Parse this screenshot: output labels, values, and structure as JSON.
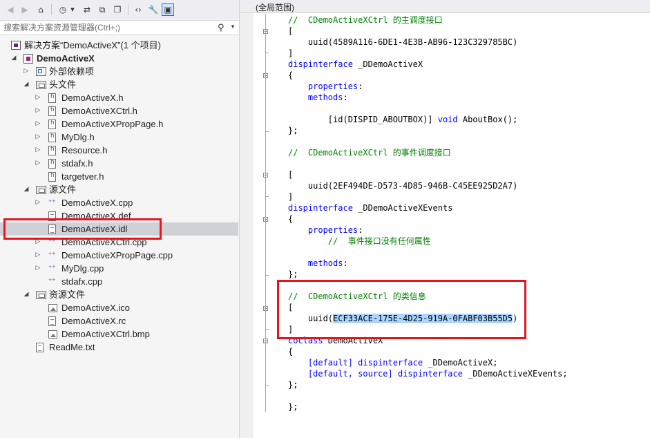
{
  "explorer": {
    "search_placeholder": "搜索解决方案资源管理器(Ctrl+;)",
    "tree": [
      {
        "label": "解决方案“DemoActiveX”(1 个项目)",
        "icon": "solution-icon",
        "expander": "",
        "depth": 0
      },
      {
        "label": "DemoActiveX",
        "icon": "cpp-project-icon",
        "expander": "expanded",
        "depth": 0,
        "bold": true
      },
      {
        "label": "外部依赖项",
        "icon": "external-dependencies-icon",
        "expander": "collapsed",
        "depth": 1
      },
      {
        "label": "头文件",
        "icon": "folder-icon",
        "expander": "expanded",
        "depth": 1
      },
      {
        "label": "DemoActiveX.h",
        "icon": "header-file-icon",
        "expander": "collapsed",
        "depth": 2
      },
      {
        "label": "DemoActiveXCtrl.h",
        "icon": "header-file-icon",
        "expander": "collapsed",
        "depth": 2
      },
      {
        "label": "DemoActiveXPropPage.h",
        "icon": "header-file-icon",
        "expander": "collapsed",
        "depth": 2
      },
      {
        "label": "MyDlg.h",
        "icon": "header-file-icon",
        "expander": "collapsed",
        "depth": 2
      },
      {
        "label": "Resource.h",
        "icon": "header-file-icon",
        "expander": "collapsed",
        "depth": 2
      },
      {
        "label": "stdafx.h",
        "icon": "header-file-icon",
        "expander": "collapsed",
        "depth": 2
      },
      {
        "label": "targetver.h",
        "icon": "header-file-icon",
        "expander": "",
        "depth": 2
      },
      {
        "label": "源文件",
        "icon": "folder-icon",
        "expander": "expanded",
        "depth": 1
      },
      {
        "label": "DemoActiveX.cpp",
        "icon": "cpp-file-icon",
        "expander": "collapsed",
        "depth": 2
      },
      {
        "label": "DemoActiveX.def",
        "icon": "def-file-icon",
        "expander": "",
        "depth": 2
      },
      {
        "label": "DemoActiveX.idl",
        "icon": "idl-file-icon",
        "expander": "",
        "depth": 2,
        "selected": true
      },
      {
        "label": "DemoActiveXCtrl.cpp",
        "icon": "cpp-file-icon",
        "expander": "collapsed",
        "depth": 2
      },
      {
        "label": "DemoActiveXPropPage.cpp",
        "icon": "cpp-file-icon",
        "expander": "collapsed",
        "depth": 2
      },
      {
        "label": "MyDlg.cpp",
        "icon": "cpp-file-icon",
        "expander": "collapsed",
        "depth": 2
      },
      {
        "label": "stdafx.cpp",
        "icon": "cpp-file-icon",
        "expander": "",
        "depth": 2
      },
      {
        "label": "资源文件",
        "icon": "folder-icon",
        "expander": "expanded",
        "depth": 1
      },
      {
        "label": "DemoActiveX.ico",
        "icon": "image-file-icon",
        "expander": "",
        "depth": 2
      },
      {
        "label": "DemoActiveX.rc",
        "icon": "resource-file-icon",
        "expander": "",
        "depth": 2
      },
      {
        "label": "DemoActiveXCtrl.bmp",
        "icon": "image-file-icon",
        "expander": "",
        "depth": 2
      },
      {
        "label": "ReadMe.txt",
        "icon": "text-file-icon",
        "expander": "",
        "depth": 1
      }
    ]
  },
  "editor": {
    "scope_label": "(全局范围)",
    "lines": [
      [
        {
          "t": "//  CDemoActiveXCtrl 的主调度接口",
          "c": "cm"
        }
      ],
      [
        {
          "t": "["
        }
      ],
      [
        {
          "t": "    uuid(4589A116-6DE1-4E3B-AB96-123C329785BC)"
        }
      ],
      [
        {
          "t": "]"
        }
      ],
      [
        {
          "t": "dispinterface",
          "c": "kw"
        },
        {
          "t": " _DDemoActiveX"
        }
      ],
      [
        {
          "t": "{"
        }
      ],
      [
        {
          "t": "    "
        },
        {
          "t": "properties",
          "c": "kw"
        },
        {
          "t": ":"
        }
      ],
      [
        {
          "t": "    "
        },
        {
          "t": "methods",
          "c": "kw"
        },
        {
          "t": ":"
        }
      ],
      [
        {
          "t": ""
        }
      ],
      [
        {
          "t": "        [id(DISPID_ABOUTBOX)] "
        },
        {
          "t": "void",
          "c": "kw"
        },
        {
          "t": " AboutBox();"
        }
      ],
      [
        {
          "t": "};"
        }
      ],
      [
        {
          "t": ""
        }
      ],
      [
        {
          "t": "//  CDemoActiveXCtrl 的事件调度接口",
          "c": "cm"
        }
      ],
      [
        {
          "t": ""
        }
      ],
      [
        {
          "t": "["
        }
      ],
      [
        {
          "t": "    uuid(2EF494DE-D573-4D85-946B-C45EE925D2A7)"
        }
      ],
      [
        {
          "t": "]"
        }
      ],
      [
        {
          "t": "dispinterface",
          "c": "kw"
        },
        {
          "t": " _DDemoActiveXEvents"
        }
      ],
      [
        {
          "t": "{"
        }
      ],
      [
        {
          "t": "    "
        },
        {
          "t": "properties",
          "c": "kw"
        },
        {
          "t": ":"
        }
      ],
      [
        {
          "t": "        //  事件接口没有任何属性",
          "c": "cm"
        }
      ],
      [
        {
          "t": ""
        }
      ],
      [
        {
          "t": "    "
        },
        {
          "t": "methods",
          "c": "kw"
        },
        {
          "t": ":"
        }
      ],
      [
        {
          "t": "};"
        }
      ],
      [
        {
          "t": ""
        }
      ],
      [
        {
          "t": "//  CDemoActiveXCtrl 的类信息",
          "c": "cm"
        }
      ],
      [
        {
          "t": "["
        }
      ],
      [
        {
          "t": "    uuid("
        },
        {
          "t": "ECF33ACE-175E-4D25-919A-0FABF03B55D5",
          "c": "sel-text"
        },
        {
          "t": ")"
        }
      ],
      [
        {
          "t": "]"
        }
      ],
      [
        {
          "t": "coclass",
          "c": "kw"
        },
        {
          "t": " DemoActiveX"
        }
      ],
      [
        {
          "t": "{"
        }
      ],
      [
        {
          "t": "    "
        },
        {
          "t": "[default]",
          "c": "kw"
        },
        {
          "t": " "
        },
        {
          "t": "dispinterface",
          "c": "kw"
        },
        {
          "t": " _DDemoActiveX;"
        }
      ],
      [
        {
          "t": "    "
        },
        {
          "t": "[default, source]",
          "c": "kw"
        },
        {
          "t": " "
        },
        {
          "t": "dispinterface",
          "c": "kw"
        },
        {
          "t": " _DDemoActiveXEvents;"
        }
      ],
      [
        {
          "t": "};"
        }
      ],
      [
        {
          "t": ""
        }
      ],
      [
        {
          "t": "};"
        }
      ]
    ]
  },
  "colors": {
    "annotation": "#e8141c",
    "comment": "#008000",
    "keyword": "#0000ff",
    "selection": "#add6ff"
  }
}
